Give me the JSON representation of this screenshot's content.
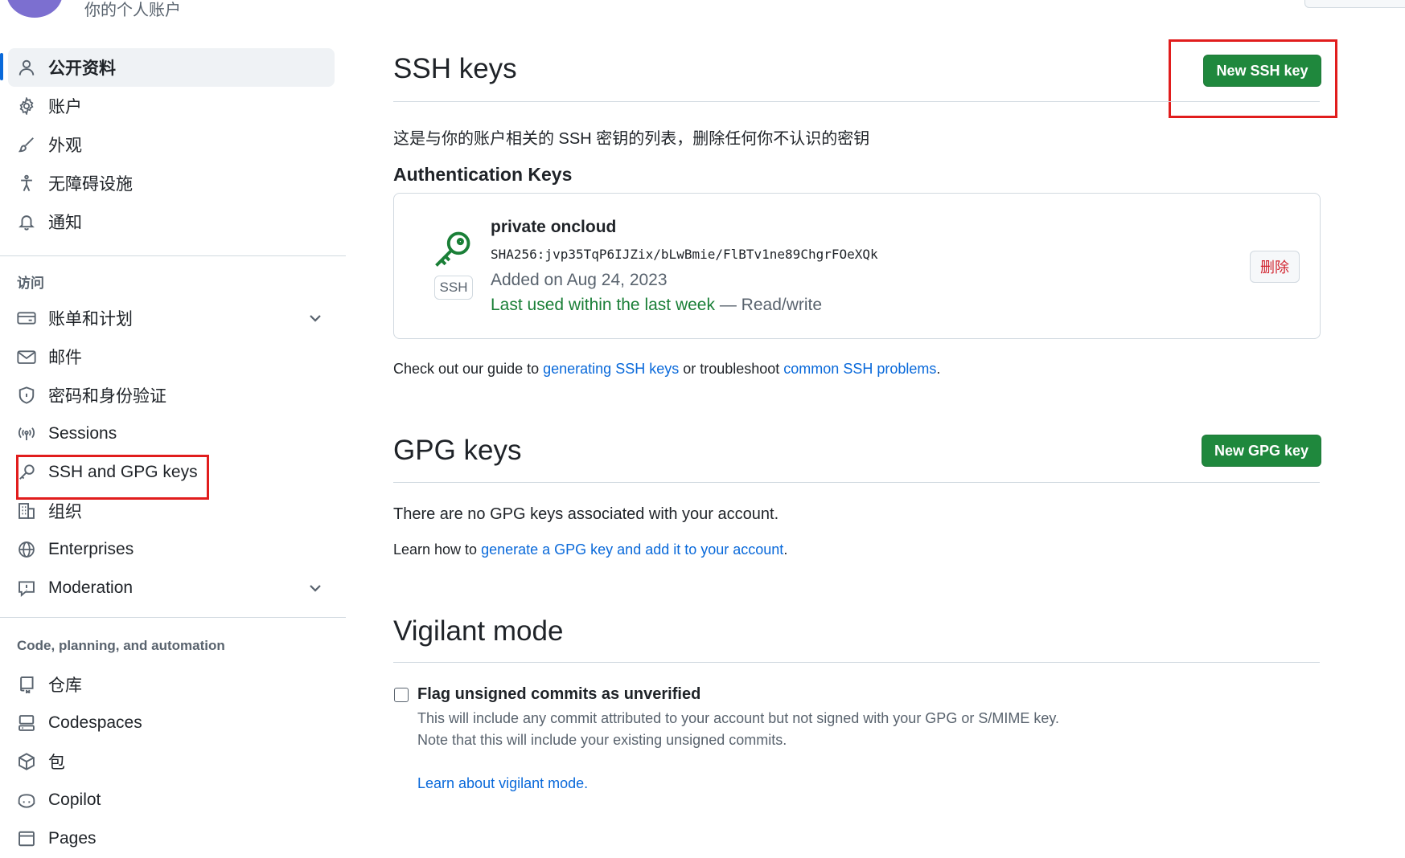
{
  "header": {
    "subtitle": "你的个人账户"
  },
  "sidebar": {
    "items_top": [
      {
        "label": "公开资料",
        "icon": "person-icon"
      },
      {
        "label": "账户",
        "icon": "gear-icon"
      },
      {
        "label": "外观",
        "icon": "paintbrush-icon"
      },
      {
        "label": "无障碍设施",
        "icon": "accessibility-icon"
      },
      {
        "label": "通知",
        "icon": "bell-icon"
      }
    ],
    "access_heading": "访问",
    "items_access": [
      {
        "label": "账单和计划",
        "icon": "credit-card-icon"
      },
      {
        "label": "邮件",
        "icon": "mail-icon"
      },
      {
        "label": "密码和身份验证",
        "icon": "shield-lock-icon"
      },
      {
        "label": "Sessions",
        "icon": "broadcast-icon"
      },
      {
        "label": "SSH and GPG keys",
        "icon": "key-icon"
      },
      {
        "label": "组织",
        "icon": "organization-icon"
      },
      {
        "label": "Enterprises",
        "icon": "globe-icon"
      },
      {
        "label": "Moderation",
        "icon": "report-icon"
      }
    ],
    "code_heading": "Code, planning, and automation",
    "items_code": [
      {
        "label": "仓库",
        "icon": "repo-icon"
      },
      {
        "label": "Codespaces",
        "icon": "codespaces-icon"
      },
      {
        "label": "包",
        "icon": "package-icon"
      },
      {
        "label": "Copilot",
        "icon": "copilot-icon"
      },
      {
        "label": "Pages",
        "icon": "browser-icon"
      }
    ]
  },
  "ssh": {
    "title": "SSH keys",
    "new_button": "New SSH key",
    "description": "这是与你的账户相关的 SSH 密钥的列表，删除任何你不认识的密钥",
    "auth_heading": "Authentication Keys",
    "key": {
      "badge": "SSH",
      "name": "private oncloud",
      "fingerprint": "SHA256:jvp35TqP6IJZix/bLwBmie/FlBTv1ne89ChgrFOeXQk",
      "added": "Added on Aug 24, 2023",
      "last_used": "Last used within the last week",
      "access": " — Read/write",
      "delete_button": "删除"
    },
    "guide_prefix": "Check out our guide to ",
    "guide_link1": "generating SSH keys",
    "guide_mid": " or troubleshoot ",
    "guide_link2": "common SSH problems",
    "guide_suffix": "."
  },
  "gpg": {
    "title": "GPG keys",
    "new_button": "New GPG key",
    "empty": "There are no GPG keys associated with your account.",
    "learn_prefix": "Learn how to ",
    "learn_link": "generate a GPG key and add it to your account",
    "learn_suffix": "."
  },
  "vigilant": {
    "title": "Vigilant mode",
    "checkbox_label": "Flag unsigned commits as unverified",
    "desc1": "This will include any commit attributed to your account but not signed with your GPG or S/MIME key.",
    "desc2": "Note that this will include your existing unsigned commits.",
    "learn_link": "Learn about vigilant mode."
  },
  "colors": {
    "primary_green": "#1f883d",
    "link_blue": "#0969da",
    "highlight_red": "#e11d1d"
  }
}
